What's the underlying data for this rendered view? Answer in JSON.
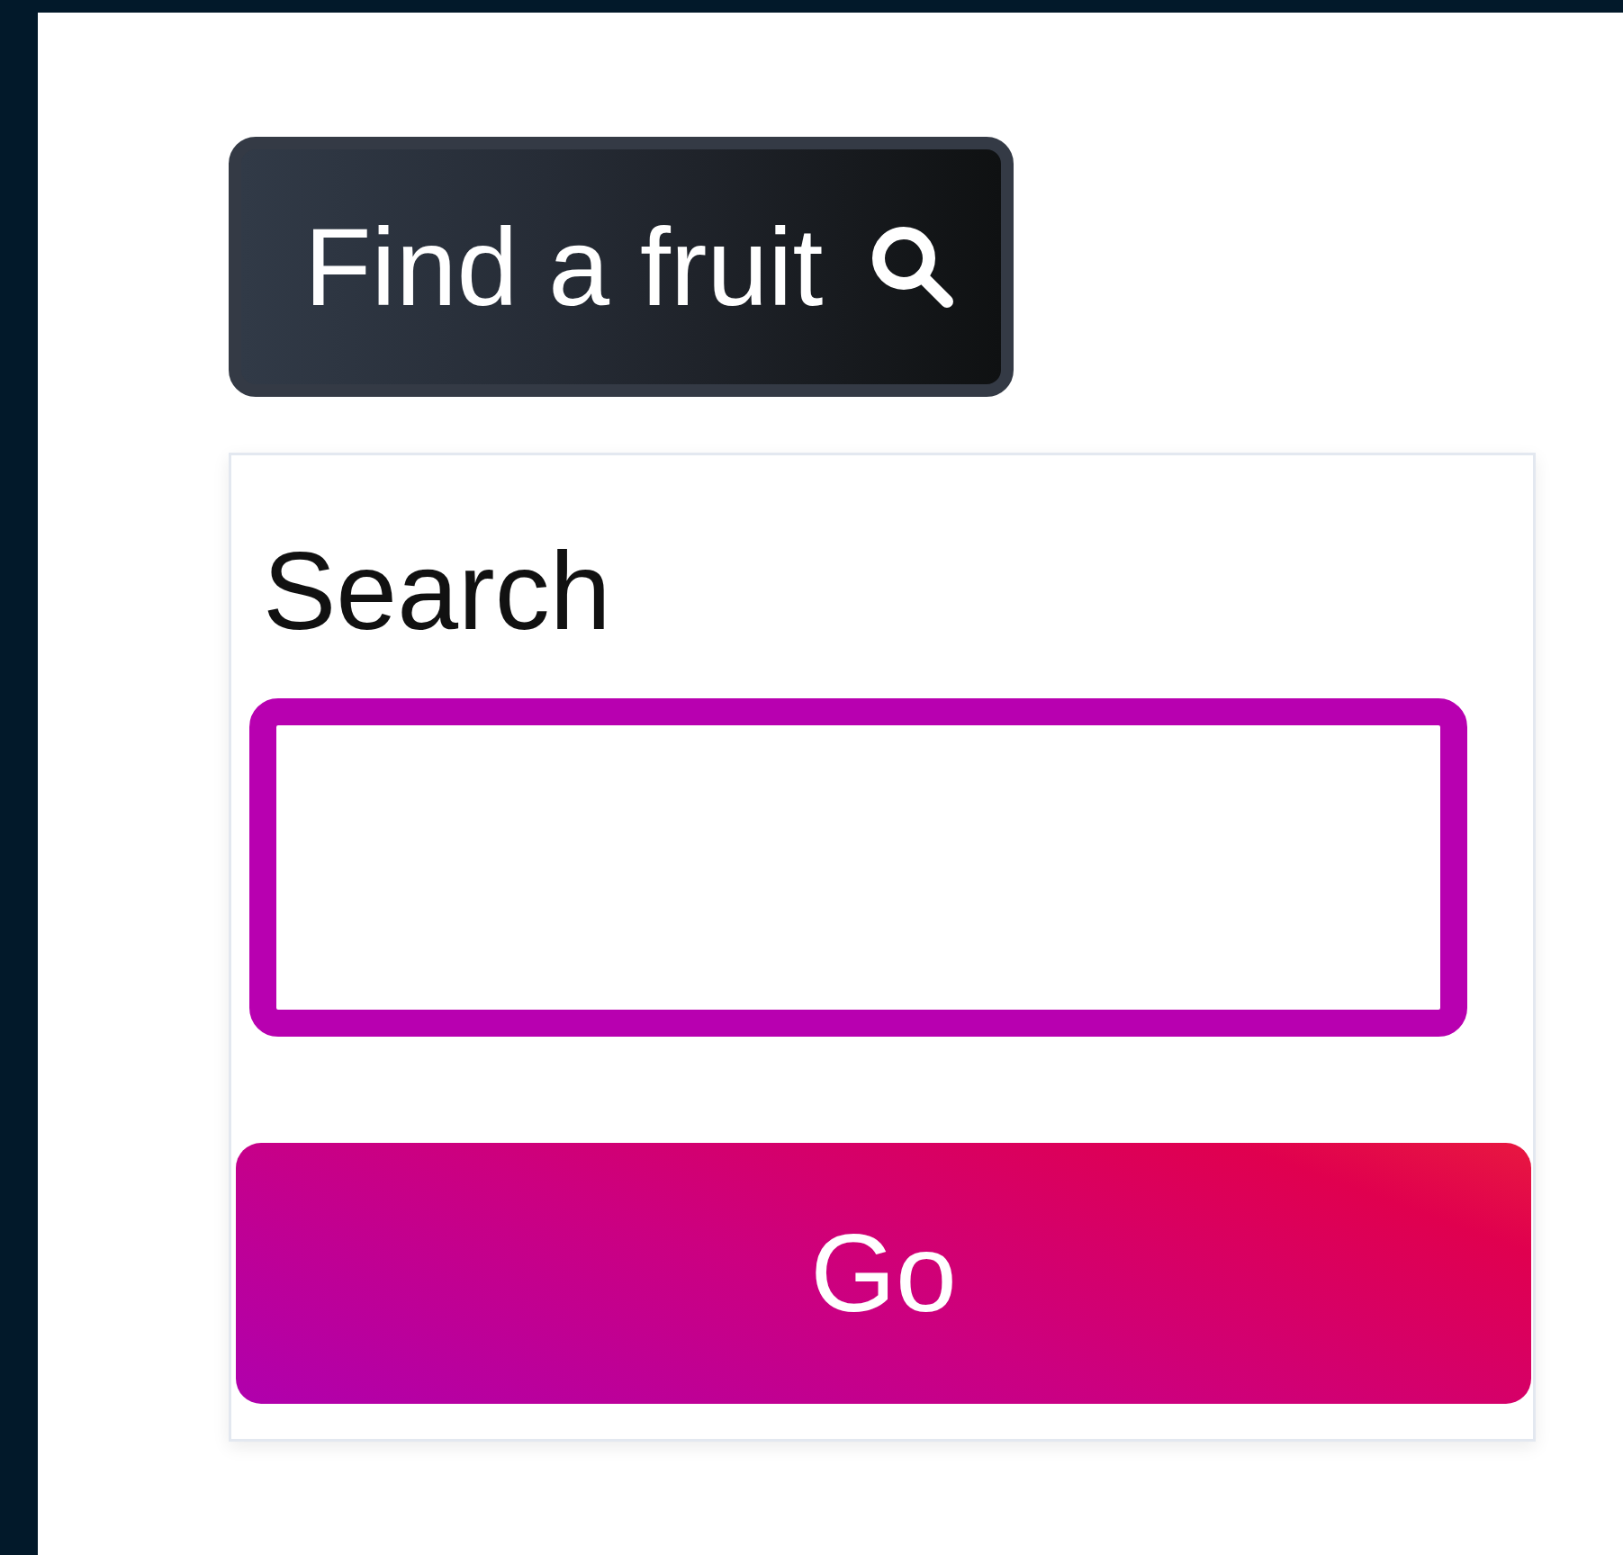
{
  "header_button": {
    "label": "Find a fruit"
  },
  "search": {
    "label": "Search",
    "focused": true
  },
  "submit_button": {
    "label": "Go"
  }
}
